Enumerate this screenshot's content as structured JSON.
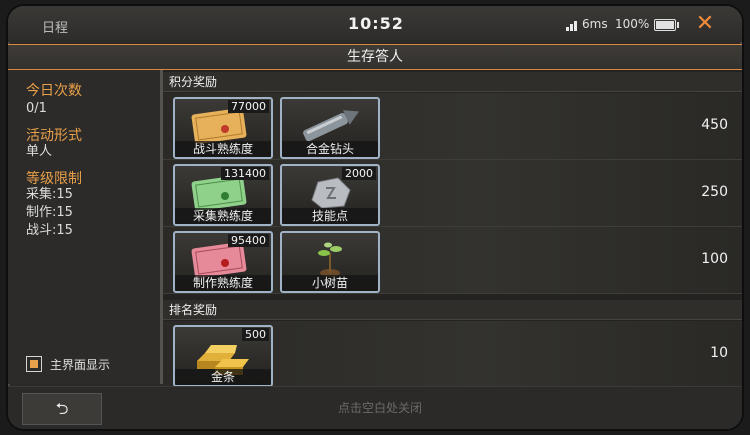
{
  "status_bar": {
    "left_label": "日程",
    "time": "10:52",
    "ping": "6ms",
    "battery": "100%",
    "close_glyph": "✕"
  },
  "title": "生存答人",
  "left_panel": {
    "daily_count_label": "今日次数",
    "daily_count_value": "0/1",
    "activity_form_label": "活动形式",
    "activity_form_value": "单人",
    "level_limit_label": "等级限制",
    "level_limits": [
      "采集:15",
      "制作:15",
      "战斗:15"
    ],
    "show_on_main_label": "主界面显示"
  },
  "score_rewards": {
    "header": "积分奖励",
    "rows": [
      {
        "points": "450",
        "items": [
          {
            "name": "战斗熟练度",
            "qty": "77000",
            "icon": "scroll-icon"
          },
          {
            "name": "合金钻头",
            "qty": "",
            "icon": "drill-bit-icon"
          }
        ]
      },
      {
        "points": "250",
        "items": [
          {
            "name": "采集熟练度",
            "qty": "131400",
            "icon": "scroll-icon"
          },
          {
            "name": "技能点",
            "qty": "2000",
            "icon": "skill-stone-icon"
          }
        ]
      },
      {
        "points": "100",
        "items": [
          {
            "name": "制作熟练度",
            "qty": "95400",
            "icon": "scroll-icon"
          },
          {
            "name": "小树苗",
            "qty": "",
            "icon": "sapling-icon"
          }
        ]
      }
    ]
  },
  "rank_rewards": {
    "header": "排名奖励",
    "rows": [
      {
        "points": "10",
        "items": [
          {
            "name": "金条",
            "qty": "500",
            "icon": "gold-bars-icon"
          }
        ]
      }
    ]
  },
  "bottom_bar": {
    "back_glyph": "⮌",
    "hint": "点击空白处关闭"
  },
  "colors": {
    "accent": "#e8a04a",
    "close": "#f08a3a",
    "scroll_orange": "#e6b15a",
    "scroll_green": "#8fd08a",
    "scroll_pink": "#e68a9a"
  }
}
